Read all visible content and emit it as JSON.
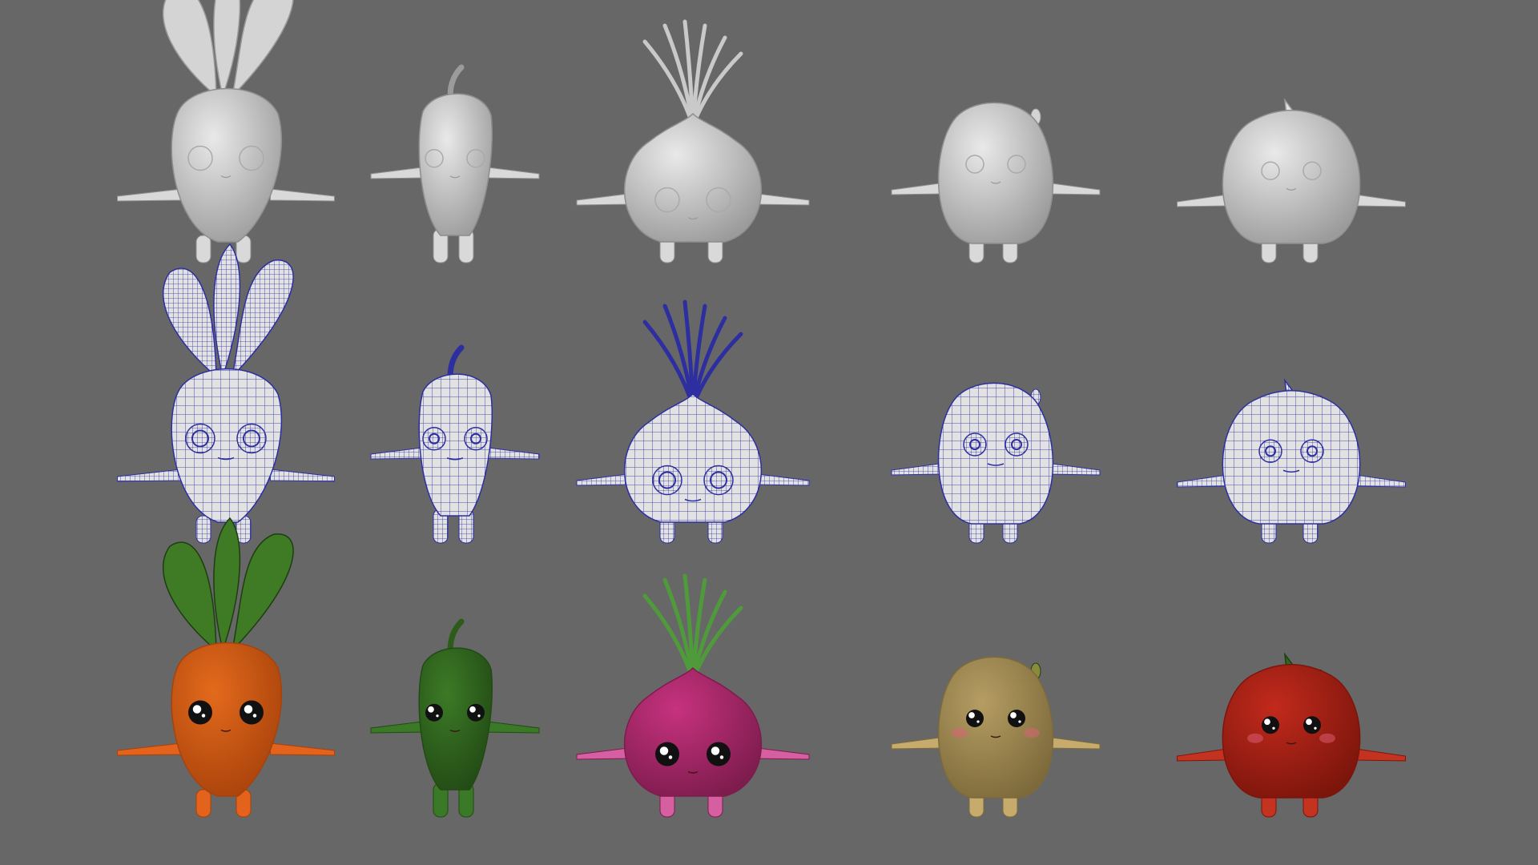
{
  "scene": {
    "background": "#676767",
    "row_styles": [
      "clay",
      "wireframe",
      "textured"
    ],
    "characters": [
      {
        "id": "carrot",
        "top": "leaves",
        "color": "#e36a1c",
        "shade": "#a8420b",
        "limb": "#e3631c",
        "top_color": "#3f7a25"
      },
      {
        "id": "pepper",
        "top": "stem",
        "color": "#3c7a26",
        "shade": "#224a15",
        "limb": "#3a7a26",
        "top_color": "#2d5c1a"
      },
      {
        "id": "onion",
        "top": "sprouts",
        "color": "#c6327f",
        "shade": "#7e1c4d",
        "limb": "#d65fa2",
        "top_color": "#4f9a3a"
      },
      {
        "id": "potato",
        "top": "nubs",
        "color": "#b59d63",
        "shade": "#7d6a3b",
        "limb": "#c6ab6c",
        "top_color": "#8a8a3a"
      },
      {
        "id": "tomato",
        "top": "calyx",
        "color": "#c12a1c",
        "shade": "#7c150c",
        "limb": "#c33320",
        "top_color": "#2c6b1c"
      }
    ],
    "clay_color": "#d4d4d4",
    "clay_shade": "#9b9b9b",
    "wire_color": "#2d2fa0",
    "wire_base": "#e2e2e2"
  }
}
